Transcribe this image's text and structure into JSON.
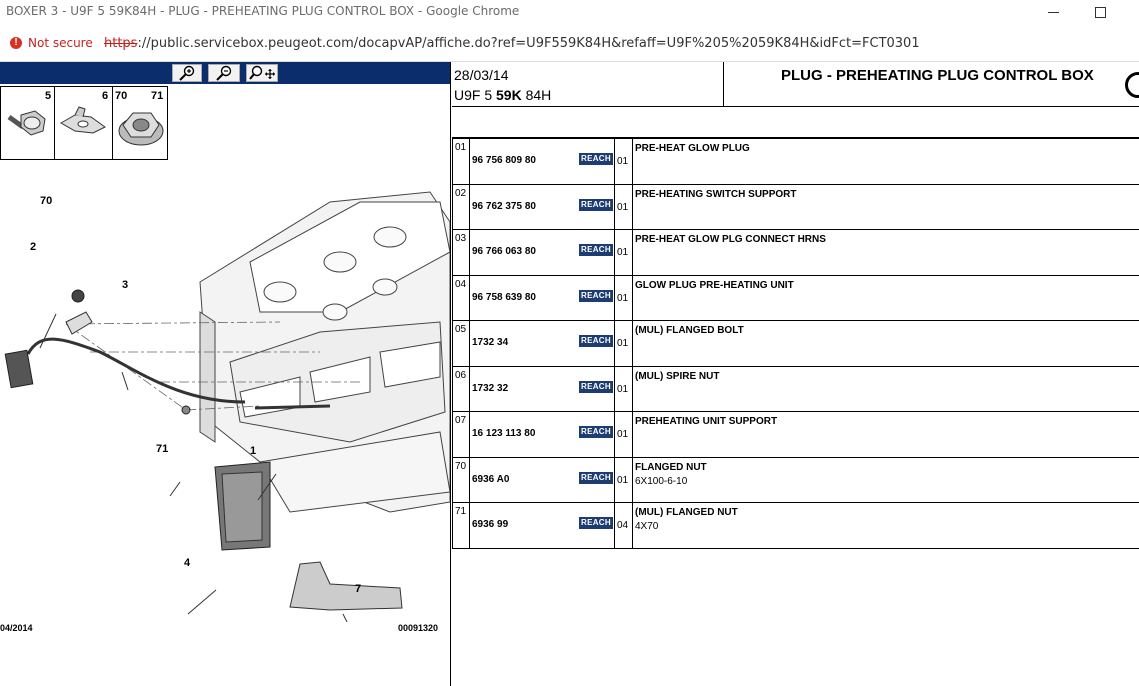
{
  "window": {
    "title": "BOXER 3 - U9F 5 59K84H - PLUG - PREHEATING PLUG CONTROL BOX - Google Chrome"
  },
  "addressbar": {
    "security_label": "Not secure",
    "url_scheme": "https",
    "url_rest": "://public.servicebox.peugeot.com/docapvAP/affiche.do?ref=U9F559K84H&refaff=U9F%205%2059K84H&idFct=FCT0301"
  },
  "illustration": {
    "thumb_labels": [
      "5",
      "6",
      "70",
      "71"
    ],
    "callouts": [
      "70",
      "2",
      "3",
      "71",
      "1",
      "4",
      "7"
    ],
    "footer_date": "04/2014",
    "footer_code": "00091320"
  },
  "header": {
    "date": "28/03/14",
    "model_prefix": "U9F 5 ",
    "model_bold": "59K",
    "model_suffix": " 84H",
    "title": "PLUG - PREHEATING PLUG CONTROL BOX"
  },
  "parts": [
    {
      "ref": "01",
      "part_number": "96 756 809 80",
      "badge": "REACH",
      "qty": "01",
      "description": "PRE-HEAT GLOW PLUG",
      "detail": ""
    },
    {
      "ref": "02",
      "part_number": "96 762 375 80",
      "badge": "REACH",
      "qty": "01",
      "description": "PRE-HEATING SWITCH SUPPORT",
      "detail": ""
    },
    {
      "ref": "03",
      "part_number": "96 766 063 80",
      "badge": "REACH",
      "qty": "01",
      "description": "PRE-HEAT GLOW PLG CONNECT HRNS",
      "detail": ""
    },
    {
      "ref": "04",
      "part_number": "96 758 639 80",
      "badge": "REACH",
      "qty": "01",
      "description": "GLOW PLUG PRE-HEATING UNIT",
      "detail": ""
    },
    {
      "ref": "05",
      "part_number": "1732 34",
      "badge": "REACH",
      "qty": "01",
      "description": "(MUL) FLANGED BOLT",
      "detail": ""
    },
    {
      "ref": "06",
      "part_number": "1732 32",
      "badge": "REACH",
      "qty": "01",
      "description": "(MUL) SPIRE NUT",
      "detail": ""
    },
    {
      "ref": "07",
      "part_number": "16 123 113 80",
      "badge": "REACH",
      "qty": "01",
      "description": "PREHEATING UNIT SUPPORT",
      "detail": ""
    },
    {
      "ref": "70",
      "part_number": "6936 A0",
      "badge": "REACH",
      "qty": "01",
      "description": "FLANGED NUT",
      "detail": "6X100-6-10"
    },
    {
      "ref": "71",
      "part_number": "6936 99",
      "badge": "REACH",
      "qty": "04",
      "description": "(MUL) FLANGED NUT",
      "detail": "4X70"
    }
  ]
}
